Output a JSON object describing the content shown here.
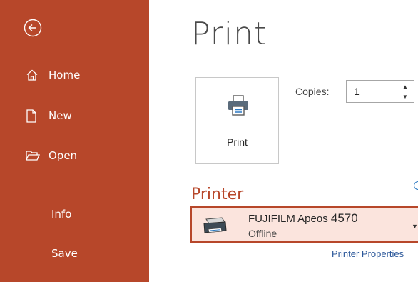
{
  "sidebar": {
    "background": "#b7472a",
    "back_icon": "back-arrow-circle-icon",
    "items": [
      {
        "label": "Home",
        "icon": "home-icon"
      },
      {
        "label": "New",
        "icon": "new-document-icon"
      },
      {
        "label": "Open",
        "icon": "open-folder-icon"
      },
      {
        "label": "Info"
      },
      {
        "label": "Save"
      }
    ]
  },
  "main": {
    "title": "Print",
    "print_button": {
      "label": "Print",
      "icon": "printer-icon"
    },
    "copies": {
      "label": "Copies:",
      "value": "1"
    },
    "printer_section": {
      "heading": "Printer",
      "selected_printer": {
        "brand": "FUJIFILM Apeos ",
        "model": "4570",
        "status": "Offline",
        "icon": "printer-device-icon"
      },
      "properties_link": "Printer Properties"
    }
  },
  "colors": {
    "accent": "#b7472a",
    "highlight": "#fbe4dd",
    "link": "#2b579a"
  }
}
